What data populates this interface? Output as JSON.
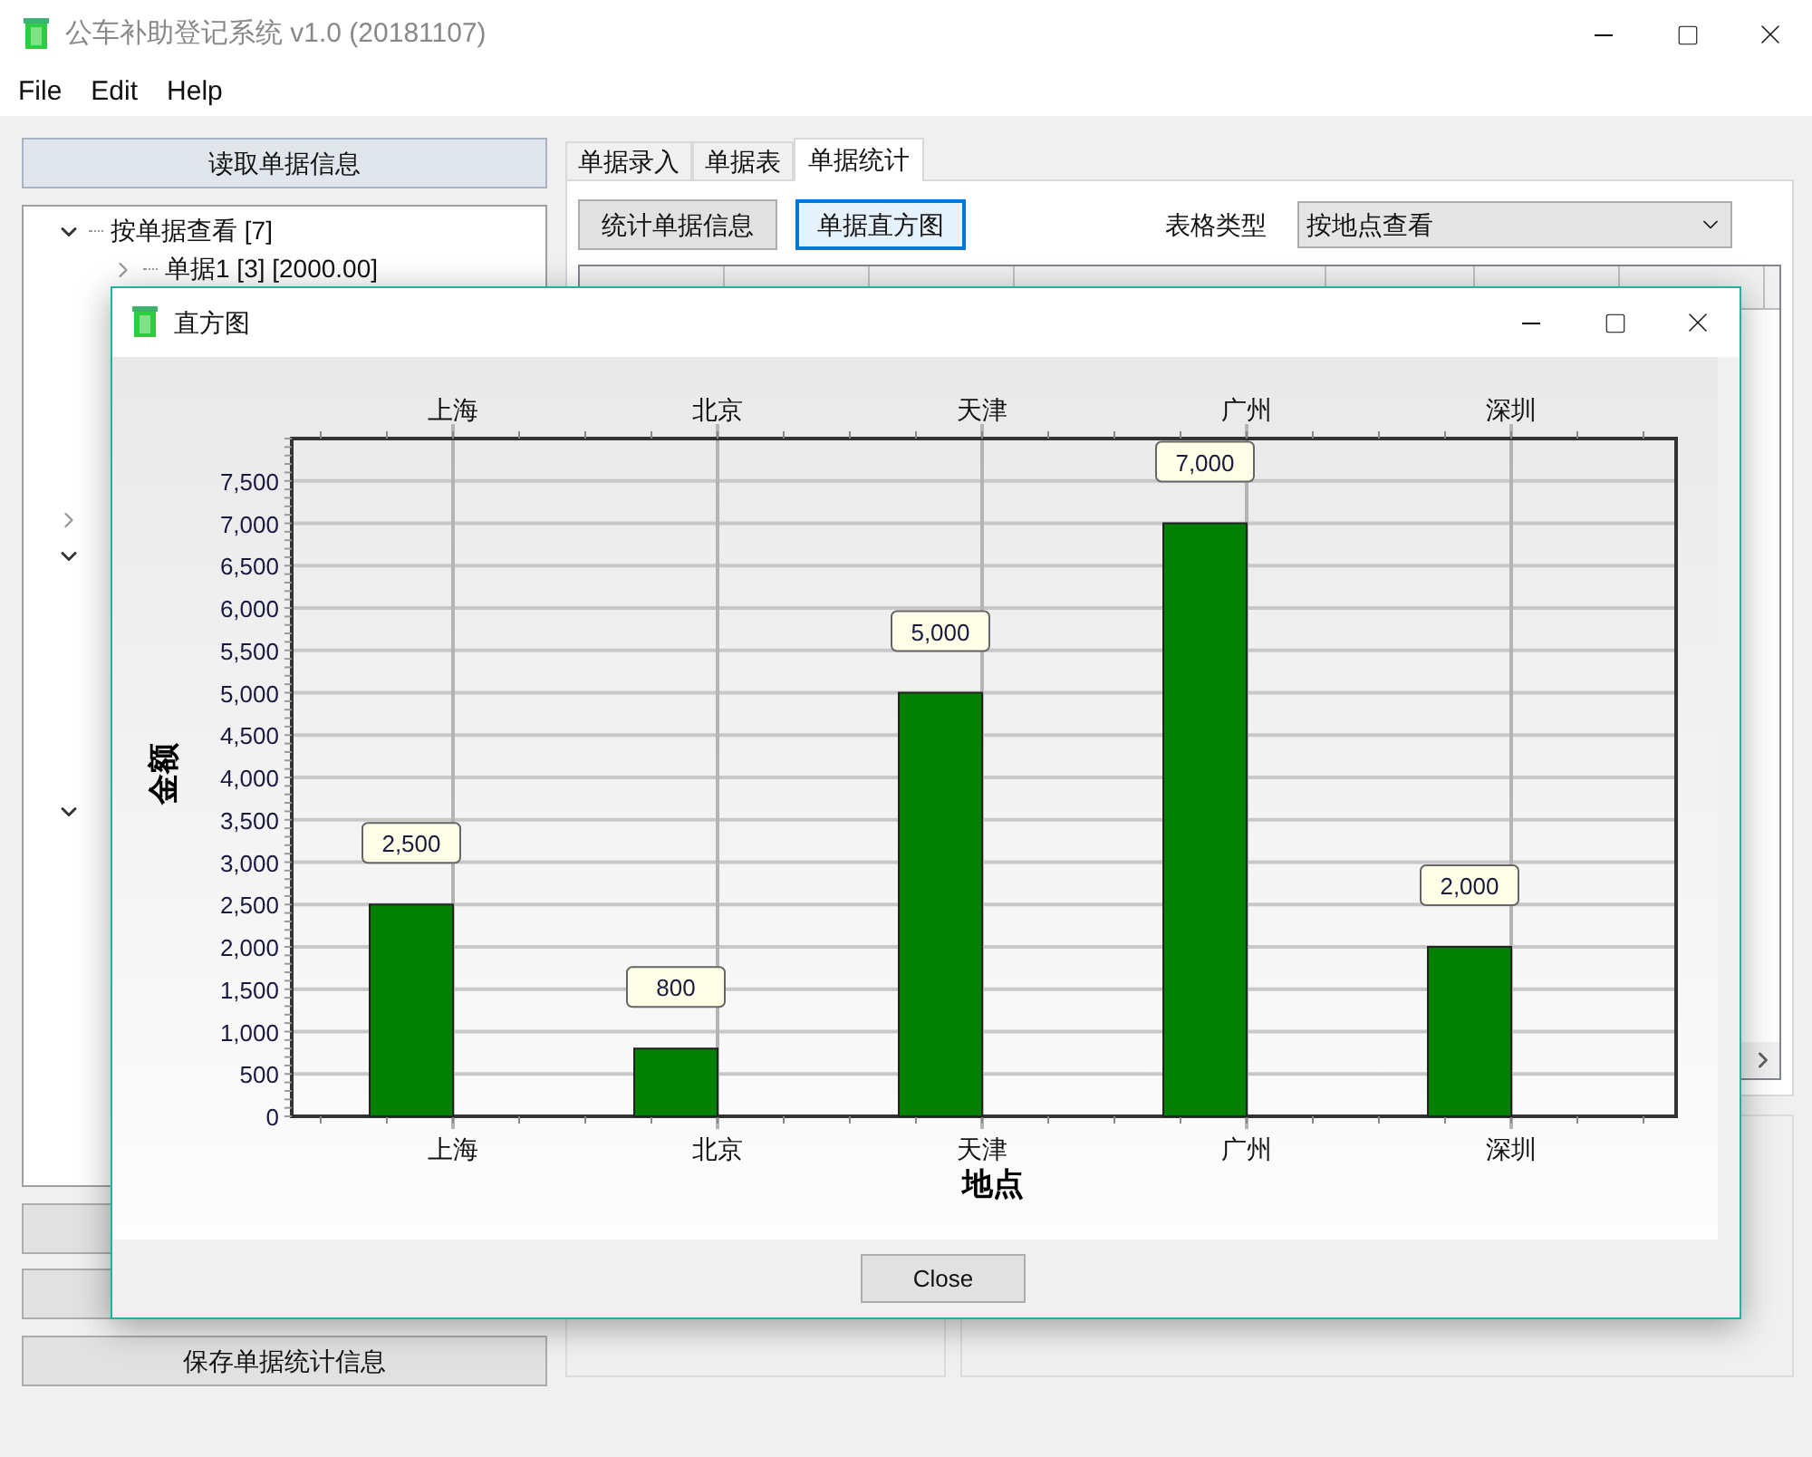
{
  "window": {
    "title": "公车补助登记系统 v1.0 (20181107)"
  },
  "menu": [
    "File",
    "Edit",
    "Help"
  ],
  "left_panel": {
    "load_button": "读取单据信息",
    "tree": [
      {
        "label": "按单据查看 [7]",
        "expanded": true,
        "children": [
          {
            "label": "单据1 [3] [2000.00]",
            "expanded": false
          }
        ]
      },
      {
        "expanded": false
      },
      {
        "expanded": true
      },
      {
        "expanded": true
      }
    ],
    "save_button": "保存单据统计信息"
  },
  "tabs": [
    {
      "label": "单据录入",
      "selected": false
    },
    {
      "label": "单据表",
      "selected": false
    },
    {
      "label": "单据统计",
      "selected": true
    }
  ],
  "toolbar": {
    "buttons": [
      {
        "label": "统计单据信息",
        "focused": false
      },
      {
        "label": "单据直方图",
        "focused": true
      }
    ],
    "table_type_label": "表格类型",
    "table_type_value": "按地点查看"
  },
  "dialog": {
    "title": "直方图",
    "close_button": "Close",
    "chart_data": {
      "type": "bar",
      "xlabel": "地点",
      "ylabel": "金额",
      "categories": [
        "上海",
        "北京",
        "天津",
        "广州",
        "深圳"
      ],
      "series": [
        {
          "color": "#008000",
          "values": [
            2500,
            800,
            5000,
            7000,
            2000
          ]
        }
      ],
      "grid": true,
      "ylim": [
        0,
        8000
      ],
      "yticks": [
        {
          "value": 0,
          "label": "0"
        },
        {
          "value": 500,
          "label": "500"
        },
        {
          "value": 1000,
          "label": "1,000"
        },
        {
          "value": 1500,
          "label": "1,500"
        },
        {
          "value": 2000,
          "label": "2,000"
        },
        {
          "value": 2500,
          "label": "2,500"
        },
        {
          "value": 3000,
          "label": "3,000"
        },
        {
          "value": 3500,
          "label": "3,500"
        },
        {
          "value": 4000,
          "label": "4,000"
        },
        {
          "value": 4500,
          "label": "4,500"
        },
        {
          "value": 5000,
          "label": "5,000"
        },
        {
          "value": 5500,
          "label": "5,500"
        },
        {
          "value": 6000,
          "label": "6,000"
        },
        {
          "value": 6500,
          "label": "6,500"
        },
        {
          "value": 7000,
          "label": "7,000"
        },
        {
          "value": 7500,
          "label": "7,500"
        }
      ],
      "value_labels": [
        "2,500",
        "800",
        "5,000",
        "7,000",
        "2,000"
      ]
    }
  }
}
